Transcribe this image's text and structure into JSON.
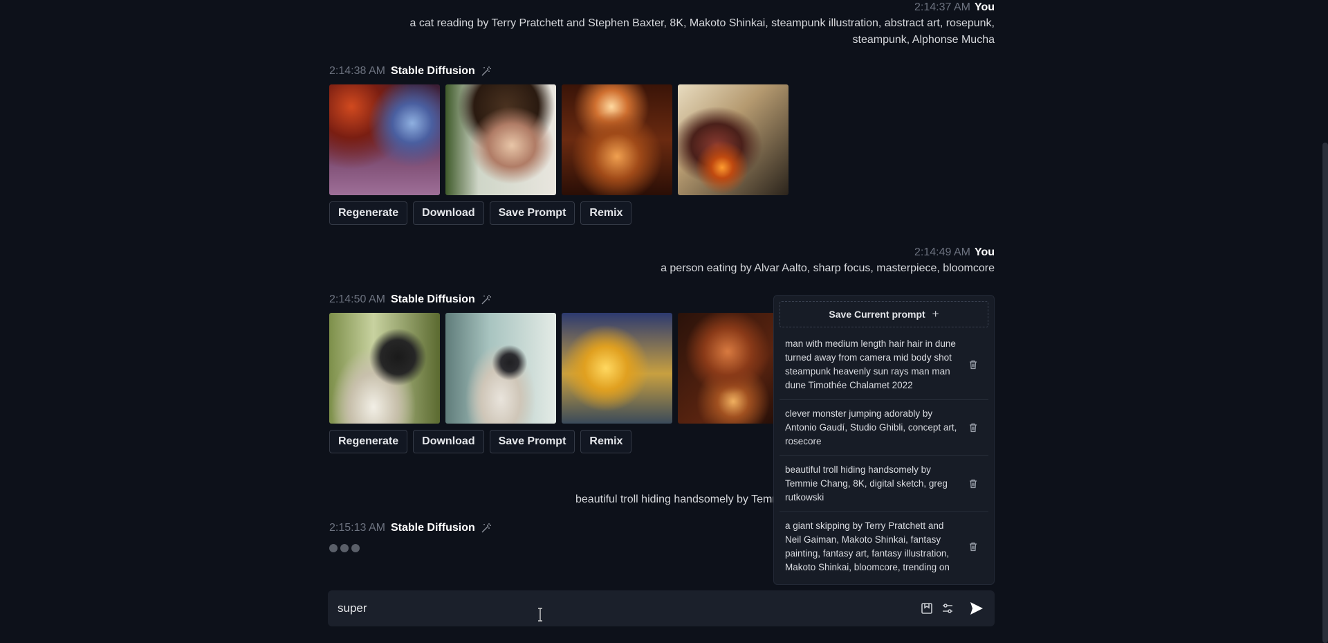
{
  "conversation": {
    "m1": {
      "time": "2:14:37 AM",
      "author": "You",
      "text": "a cat reading by Terry Pratchett and Stephen Baxter, 8K, Makoto Shinkai, steampunk illustration, abstract art, rosepunk, steampunk, Alphonse Mucha"
    },
    "m2": {
      "time": "2:14:38 AM",
      "author": "Stable Diffusion"
    },
    "m3": {
      "time": "2:14:49 AM",
      "author": "You",
      "text": "a person eating by Alvar Aalto, sharp focus, masterpiece, bloomcore"
    },
    "m4": {
      "time": "2:14:50 AM",
      "author": "Stable Diffusion"
    },
    "m5": {
      "text": "beautiful troll hiding handsomely by Temmie Chang, 8K, digital sketch, greg rutkowski"
    },
    "m6": {
      "time": "2:15:13 AM",
      "author": "Stable Diffusion"
    }
  },
  "actions": {
    "regenerate": "Regenerate",
    "download": "Download",
    "save_prompt": "Save Prompt",
    "remix": "Remix"
  },
  "saved_prompts": {
    "header": "Save Current prompt",
    "items": [
      "man with medium length hair hair in dune turned away from camera mid body shot steampunk heavenly sun rays man man dune Timothée Chalamet 2022",
      "clever monster jumping adorably by Antonio Gaudí, Studio Ghibli, concept art, rosecore",
      "beautiful troll hiding handsomely by Temmie Chang, 8K, digital sketch, greg rutkowski",
      "a giant skipping by Terry Pratchett and Neil Gaiman, Makoto Shinkai, fantasy painting, fantasy art, fantasy illustration, Makoto Shinkai, bloomcore, trending on"
    ]
  },
  "composer": {
    "value": "super "
  },
  "icons": {
    "bot": "magic-wand-icon",
    "saved": "bookmark-icon",
    "settings": "sliders-icon",
    "send": "send-icon",
    "delete": "trash-icon"
  },
  "colors": {
    "background": "#0d111a",
    "panel": "#171c26",
    "composer": "#1b202b"
  }
}
